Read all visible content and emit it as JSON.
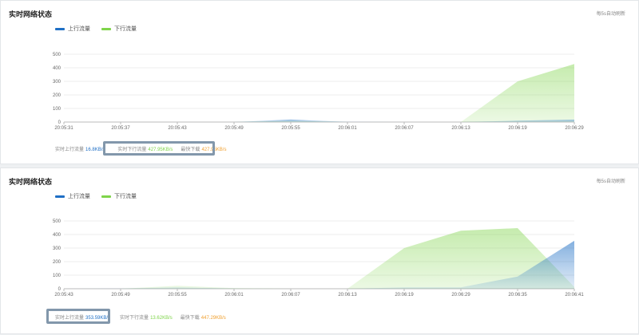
{
  "panels": [
    {
      "title": "实时网络状态",
      "refresh": "每5s自动刷新",
      "legend": [
        {
          "label": "上行流量",
          "color": "#1f6fc5"
        },
        {
          "label": "下行流量",
          "color": "#7fd44a"
        }
      ],
      "stats": {
        "up_label": "实时上行流量",
        "up_value": "16.8KB/s",
        "down_label": "实时下行流量",
        "down_value": "427.95KB/s",
        "max_label": "最快下载",
        "max_value": "427.95KB/s"
      },
      "highlight": "down"
    },
    {
      "title": "实时网络状态",
      "refresh": "每5s自动刷新",
      "legend": [
        {
          "label": "上行流量",
          "color": "#1f6fc5"
        },
        {
          "label": "下行流量",
          "color": "#7fd44a"
        }
      ],
      "stats": {
        "up_label": "实时上行流量",
        "up_value": "353.59KB/s",
        "down_label": "实时下行流量",
        "down_value": "13.62KB/s",
        "max_label": "最快下载",
        "max_value": "447.29KB/s"
      },
      "highlight": "up"
    }
  ],
  "colors": {
    "up": "#1f6fc5",
    "down": "#7fd44a",
    "max": "#f0a030",
    "highlight_border": "#8297ab"
  },
  "chart_data": [
    {
      "type": "area",
      "x": [
        "20:05:31",
        "20:05:37",
        "20:05:43",
        "20:05:49",
        "20:05:55",
        "20:06:01",
        "20:06:07",
        "20:06:13",
        "20:06:19",
        "20:06:29"
      ],
      "ylim": [
        0,
        500
      ],
      "yticks": [
        0,
        100,
        200,
        300,
        400,
        500
      ],
      "series": [
        {
          "name": "上行流量",
          "values": [
            0,
            0,
            0,
            0,
            18,
            2,
            0,
            0,
            10,
            16.8
          ]
        },
        {
          "name": "下行流量",
          "values": [
            0,
            0,
            0,
            0,
            10,
            0,
            0,
            0,
            300,
            427.95
          ]
        }
      ]
    },
    {
      "type": "area",
      "x": [
        "20:05:43",
        "20:05:49",
        "20:05:55",
        "20:06:01",
        "20:06:07",
        "20:06:13",
        "20:06:19",
        "20:06:29",
        "20:06:35",
        "20:06:41"
      ],
      "ylim": [
        0,
        500
      ],
      "yticks": [
        0,
        100,
        200,
        300,
        400,
        500
      ],
      "series": [
        {
          "name": "上行流量",
          "values": [
            0,
            2,
            10,
            2,
            0,
            0,
            10,
            10,
            90,
            353.59
          ]
        },
        {
          "name": "下行流量",
          "values": [
            0,
            0,
            22,
            5,
            0,
            0,
            300,
            428,
            447.29,
            13.62
          ]
        }
      ]
    }
  ]
}
